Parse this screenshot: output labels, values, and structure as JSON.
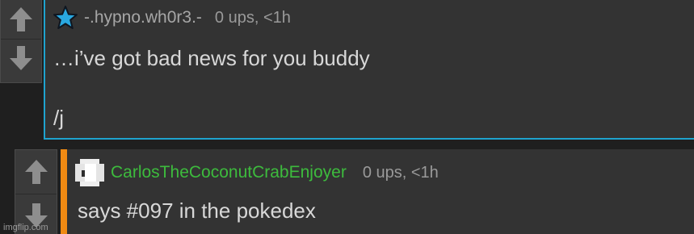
{
  "comments": [
    {
      "avatar_icon": "blue-star-icon",
      "username": "-.hypno.wh0r3.-",
      "username_color": "#a6a6a6",
      "meta": "0 ups, <1h",
      "line1": "…i’ve got bad news for you buddy",
      "line2": "/j",
      "accent_color": "#1fa3cf"
    },
    {
      "avatar_icon": "pixel-avatar-icon",
      "username": "CarlosTheCoconutCrabEnjoyer",
      "username_color": "#3dbb3d",
      "meta": "0 ups, <1h",
      "line1": "says #097 in the pokedex",
      "accent_color": "#f08a13"
    }
  ],
  "icons": {
    "upvote": "up-arrow-icon",
    "downvote": "down-arrow-icon"
  },
  "watermark": "imgflip.com"
}
